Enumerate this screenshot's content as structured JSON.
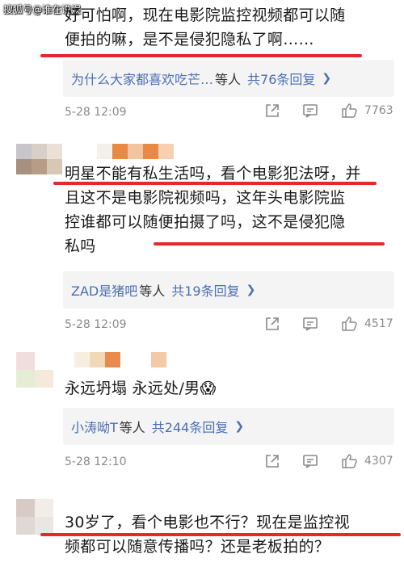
{
  "watermark": "搜狐号@谁在说娱",
  "comments": [
    {
      "text_lines": [
        "好可怕啊，现在电影院监控视频都可以随",
        "便拍的嘛，是不是侵犯隐私了啊……"
      ],
      "reply_names": "为什么大家都喜欢吃芒…",
      "reply_suffix": "等人",
      "reply_count": "共76条回复",
      "time": "5-28 12:09",
      "likes": "7763"
    },
    {
      "text_lines": [
        "明星不能有私生活吗，看个电影犯法呀，并",
        "且这不是电影院视频吗，这年头电影院监",
        "控谁都可以随便拍摄了吗，这不是侵犯隐",
        "私吗"
      ],
      "reply_names": "ZAD是猪吧",
      "reply_suffix": "等人",
      "reply_count": "共19条回复",
      "time": "5-28 12:09",
      "likes": "4517"
    },
    {
      "text_lines": [
        "永远坍塌  永远处/男😱"
      ],
      "reply_names": "小涛呦T",
      "reply_suffix": "等人",
      "reply_count": "共244条回复",
      "time": "5-28 12:10",
      "likes": "4307"
    },
    {
      "text_lines": [
        "30岁了，看个电影也不行？现在是监控视",
        "频都可以随意传播吗？还是老板拍的？"
      ]
    }
  ],
  "icons": {
    "share": "share-icon",
    "comment": "comment-icon",
    "like": "thumbs-up-icon",
    "chevron": "chevron-right-icon"
  },
  "colors": {
    "highlight_line": "#e5292b",
    "link": "#4a6fb5",
    "meta": "#8a8a8a",
    "reply_bg": "#f4f4f4"
  }
}
